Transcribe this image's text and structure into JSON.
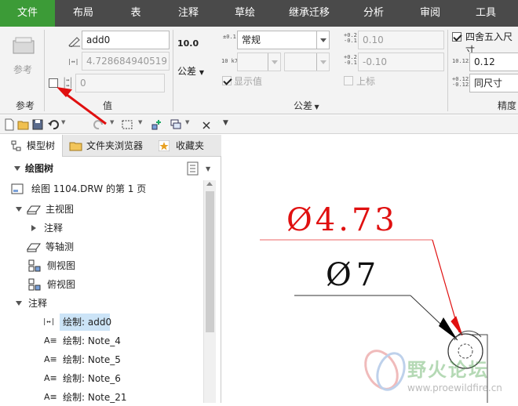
{
  "ribbon_tabs": [
    "文件",
    "布局",
    "表",
    "注释",
    "草绘",
    "继承迁移",
    "分析",
    "审阅",
    "工具"
  ],
  "ribbon": {
    "ref_group": {
      "button_label": "参考",
      "group_label": "参考"
    },
    "value_group": {
      "name_value": "add0",
      "nominal_value": "4.728684940519",
      "override_value": "0",
      "group_label": "值"
    },
    "tolerance_group": {
      "decimal_display": "10.0",
      "tol_button_label": "公差",
      "tol_type": "常规",
      "show_value_label": "显示值",
      "upper_value": "0.10",
      "lower_value": "-0.10",
      "upper_label": "上标",
      "group_label": "公差"
    },
    "precision_group": {
      "round_label": "四舍五入尺寸",
      "precision_value": "0.12",
      "same_size_label": "同尺寸",
      "group_label": "精度"
    },
    "icons": {
      "tol_icon_top": "±0.1",
      "tol_icon_k7": "10 k7",
      "prec_icon_1": "10.123",
      "prec_icon_2": "+0.123"
    }
  },
  "panel": {
    "tabs": [
      "模型树",
      "文件夹浏览器",
      "收藏夹"
    ],
    "tree_title": "绘图树",
    "rows": [
      "绘图 1104.DRW 的第 1 页",
      "主视图",
      "注释",
      "等轴测",
      "侧视图",
      "俯视图",
      "注释",
      "绘制: add0",
      "绘制: Note_4",
      "绘制: Note_5",
      "绘制: Note_6",
      "绘制: Note_21"
    ]
  },
  "drawing": {
    "dim_red": "Ø4.73",
    "dim_black": "Ø7",
    "watermark_title": "野火论坛",
    "watermark_url": "www.proewildfire.cn",
    "red": "#e01010"
  }
}
